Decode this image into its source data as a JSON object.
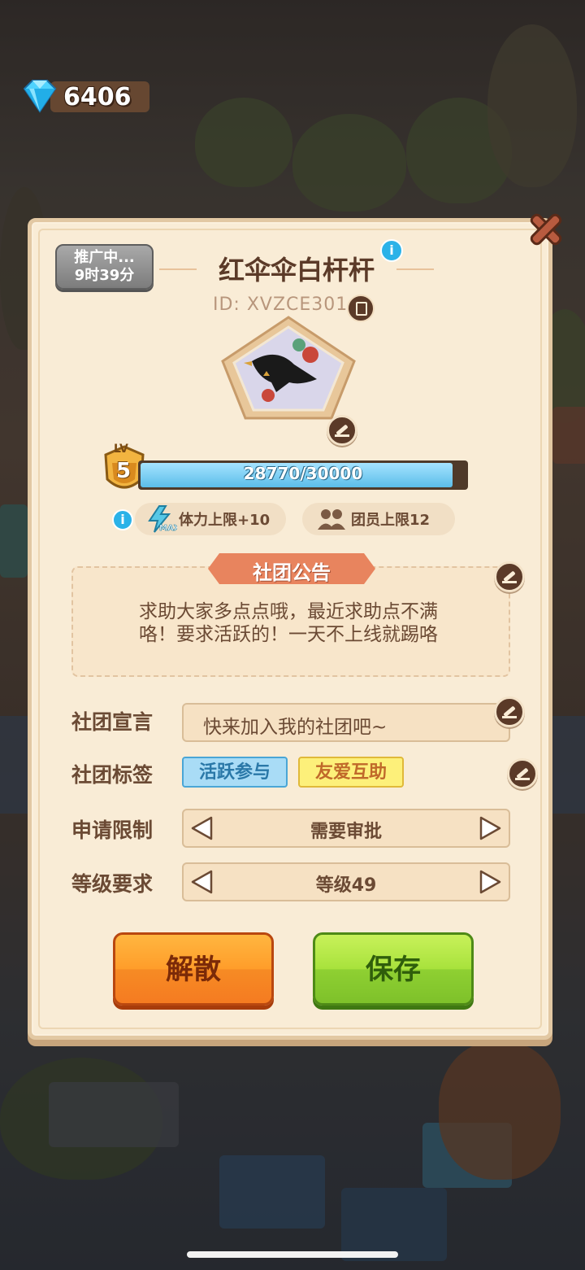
{
  "currency": {
    "icon": "diamond-icon",
    "amount": "6406"
  },
  "club": {
    "promo_line1": "推广中...",
    "promo_line2": "9时39分",
    "name": "红伞伞白杆杆",
    "id_text": "ID: XVZCE301",
    "level_label": "LV",
    "level": "5",
    "xp_text": "28770/30000",
    "xp_progress": 0.959,
    "perk_stamina": "体力上限+10",
    "perk_members": "团员上限12"
  },
  "notice": {
    "title": "社团公告",
    "line1": "求助大家多点点哦，最近求助点不满",
    "line2": "咯！要求活跃的！一天不上线就踢咯"
  },
  "settings": {
    "slogan_label": "社团宣言",
    "slogan_value": "快来加入我的社团吧~",
    "tags_label": "社团标签",
    "tags": [
      "活跃参与",
      "友爱互助"
    ],
    "apply_label": "申请限制",
    "apply_value": "需要审批",
    "level_label": "等级要求",
    "level_value": "等级49"
  },
  "buttons": {
    "disband": "解散",
    "save": "保存"
  },
  "colors": {
    "accent_orange": "#f68b24",
    "accent_green": "#8fd032",
    "panel_bg": "#f9ecd6",
    "text_brown": "#6b4a34"
  }
}
